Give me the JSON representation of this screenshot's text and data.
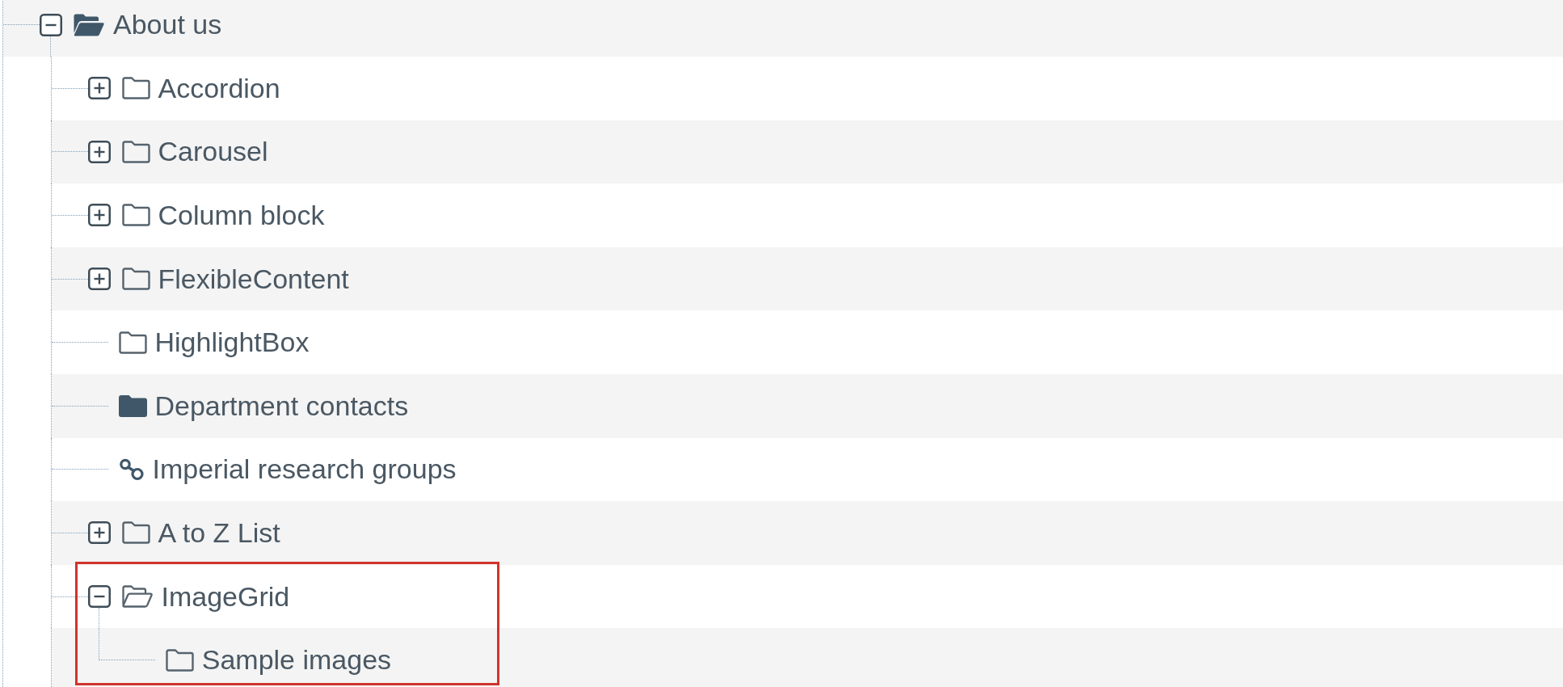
{
  "tree": [
    {
      "label": "About us",
      "kind": "folder-open-solid",
      "expandable": true,
      "expanded": true,
      "highlighted": false,
      "children": [
        {
          "label": "Accordion",
          "kind": "folder",
          "expandable": true,
          "expanded": false,
          "highlighted": false
        },
        {
          "label": "Carousel",
          "kind": "folder",
          "expandable": true,
          "expanded": false,
          "highlighted": false
        },
        {
          "label": "Column block",
          "kind": "folder",
          "expandable": true,
          "expanded": false,
          "highlighted": false
        },
        {
          "label": "FlexibleContent",
          "kind": "folder",
          "expandable": true,
          "expanded": false,
          "highlighted": false
        },
        {
          "label": "HighlightBox",
          "kind": "folder",
          "expandable": false,
          "highlighted": false
        },
        {
          "label": "Department contacts",
          "kind": "folder-solid",
          "expandable": false,
          "highlighted": false
        },
        {
          "label": "Imperial research groups",
          "kind": "link",
          "expandable": false,
          "highlighted": false
        },
        {
          "label": "A to Z List",
          "kind": "folder",
          "expandable": true,
          "expanded": false,
          "highlighted": false
        },
        {
          "label": "ImageGrid",
          "kind": "folder-open",
          "expandable": true,
          "expanded": true,
          "highlighted": true,
          "children": [
            {
              "label": "Sample images",
              "kind": "folder",
              "expandable": false,
              "highlighted": false
            }
          ]
        }
      ]
    }
  ]
}
